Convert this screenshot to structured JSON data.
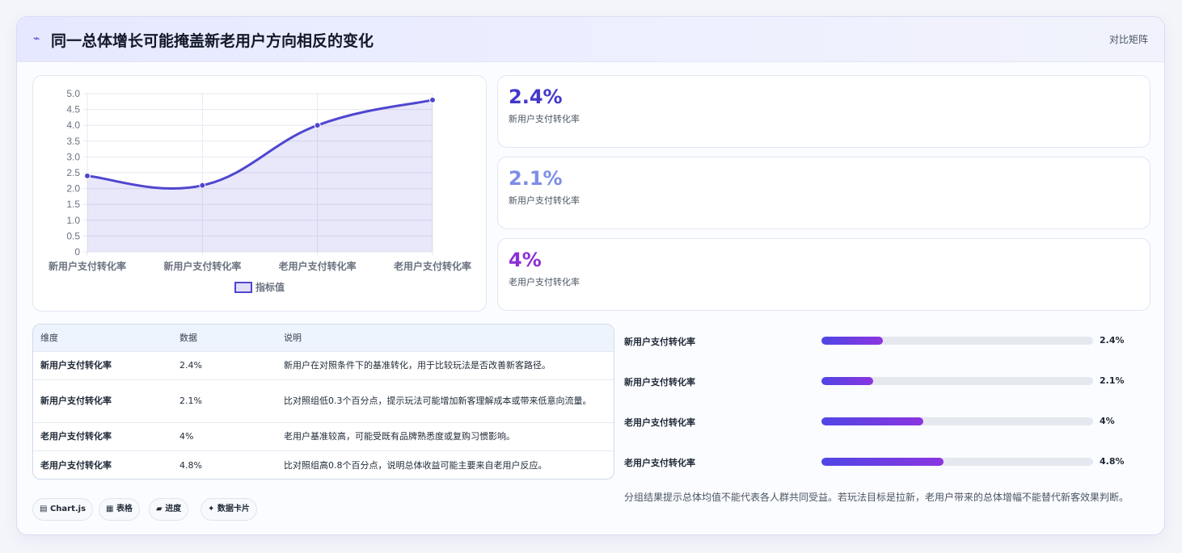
{
  "header": {
    "icon": "trend-line-icon",
    "title": "同一总体增长可能掩盖新老用户方向相反的变化",
    "right_label": "对比矩阵"
  },
  "chart_data": {
    "type": "line",
    "categories": [
      "新用户支付转化率",
      "新用户支付转化率",
      "老用户支付转化率",
      "老用户支付转化率"
    ],
    "series": [
      {
        "name": "指标值",
        "values": [
          2.4,
          2.1,
          4.0,
          4.8
        ]
      }
    ],
    "ylim": [
      0,
      5.0
    ],
    "yticks": [
      "0",
      "0.5",
      "1.0",
      "1.5",
      "2.0",
      "2.5",
      "3.0",
      "3.5",
      "4.0",
      "4.5",
      "5.0"
    ],
    "grid": true,
    "legend": "bottom",
    "fill": true,
    "color": "#4f46d0"
  },
  "kpis": [
    {
      "value": "2.4%",
      "label": "新用户支付转化率",
      "color": "#4338ca"
    },
    {
      "value": "2.1%",
      "label": "新用户支付转化率",
      "color": "#7c8ee6"
    },
    {
      "value": "4%",
      "label": "老用户支付转化率",
      "color": "#8b2fd6"
    }
  ],
  "table": {
    "headers": [
      "维度",
      "数据",
      "说明"
    ],
    "rows": [
      {
        "dim": "新用户支付转化率",
        "data": "2.4%",
        "desc": "新用户在对照条件下的基准转化，用于比较玩法是否改善新客路径。"
      },
      {
        "dim": "新用户支付转化率",
        "data": "2.1%",
        "desc": "比对照组低0.3个百分点，提示玩法可能增加新客理解成本或带来低意向流量。"
      },
      {
        "dim": "老用户支付转化率",
        "data": "4%",
        "desc": "老用户基准较高，可能受既有品牌熟悉度或复购习惯影响。"
      },
      {
        "dim": "老用户支付转化率",
        "data": "4.8%",
        "desc": "比对照组高0.8个百分点，说明总体收益可能主要来自老用户反应。"
      }
    ]
  },
  "progress": [
    {
      "label": "新用户支付转化率",
      "value": "2.4%",
      "fraction": 0.225
    },
    {
      "label": "新用户支付转化率",
      "value": "2.1%",
      "fraction": 0.19
    },
    {
      "label": "老用户支付转化率",
      "value": "4%",
      "fraction": 0.375
    },
    {
      "label": "老用户支付转化率",
      "value": "4.8%",
      "fraction": 0.45
    }
  ],
  "note": "分组结果提示总体均值不能代表各人群共同受益。若玩法目标是拉新，老用户带来的总体增幅不能替代新客效果判断。",
  "tags": [
    {
      "icon": "chart-icon",
      "glyph": "▤",
      "label": "Chart.js"
    },
    {
      "icon": "table-icon",
      "glyph": "▦",
      "label": "表格"
    },
    {
      "icon": "progress-icon",
      "glyph": "▰",
      "label": "进度"
    },
    {
      "icon": "card-icon",
      "glyph": "✦",
      "label": "数据卡片"
    }
  ]
}
